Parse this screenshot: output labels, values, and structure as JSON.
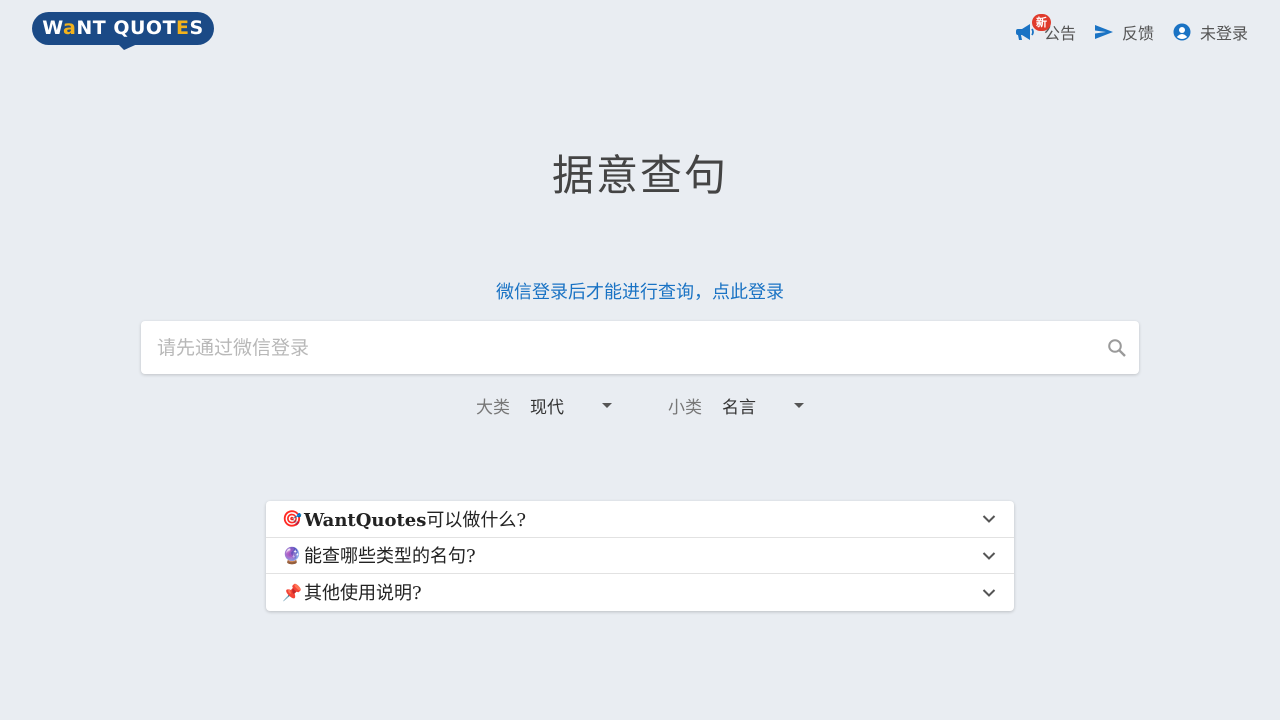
{
  "logo": {
    "text_before": "W",
    "accent_1": "a",
    "text_mid": "NT QUOT",
    "accent_2": "E",
    "text_after": "S"
  },
  "nav": {
    "announcement_label": "公告",
    "announcement_badge": "新",
    "feedback_label": "反馈",
    "login_status_label": "未登录"
  },
  "title": "据意查句",
  "login_prompt": "微信登录后才能进行查询，点此登录",
  "search": {
    "placeholder": "请先通过微信登录",
    "value": ""
  },
  "filters": {
    "category_label": "大类",
    "category_value": "现代",
    "subcategory_label": "小类",
    "subcategory_value": "名言"
  },
  "faq": [
    {
      "emoji": "🎯",
      "bold": "WantQuotes",
      "text": "可以做什么?"
    },
    {
      "emoji": "🔮",
      "bold": "",
      "text": "能查哪些类型的名句?"
    },
    {
      "emoji": "📌",
      "bold": "",
      "text": "其他使用说明?"
    }
  ],
  "colors": {
    "accent": "#1a73c4",
    "brand": "#1b4a86",
    "brand_accent": "#f2b21c",
    "badge": "#e03b2c",
    "background": "#e9edf2"
  }
}
